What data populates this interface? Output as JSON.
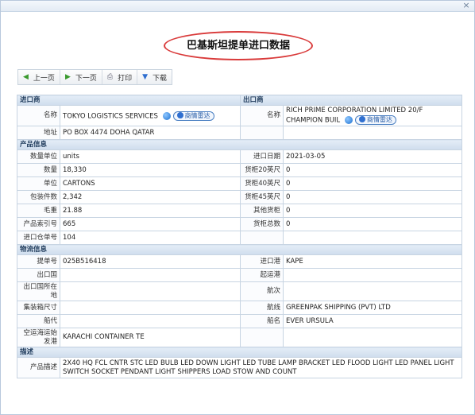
{
  "window": {
    "close_icon": "close-icon"
  },
  "page": {
    "title": "巴基斯坦提单进口数据"
  },
  "toolbar": {
    "prev_label": "上一页",
    "next_label": "下一页",
    "print_label": "打印",
    "download_label": "下载"
  },
  "importer": {
    "section_title": "进口商",
    "name_label": "名称",
    "name_value": "TOKYO LOGISTICS SERVICES",
    "address_label": "地址",
    "address_value": "PO BOX 4474 DOHA QATAR",
    "badge_label": "商情雷达"
  },
  "exporter": {
    "section_title": "出口商",
    "name_label": "名称",
    "name_value": "RICH PRIME CORPORATION LIMITED 20/F CHAMPION BUIL",
    "badge_label": "商情雷达"
  },
  "product": {
    "section_title": "产品信息",
    "rows": [
      {
        "l_label": "数量单位",
        "l_value": "units",
        "r_label": "进口日期",
        "r_value": "2021-03-05"
      },
      {
        "l_label": "数量",
        "l_value": "18,330",
        "r_label": "货柜20英尺",
        "r_value": "0"
      },
      {
        "l_label": "单位",
        "l_value": "CARTONS",
        "r_label": "货柜40英尺",
        "r_value": "0"
      },
      {
        "l_label": "包装件数",
        "l_value": "2,342",
        "r_label": "货柜45英尺",
        "r_value": "0"
      },
      {
        "l_label": "毛重",
        "l_value": "21.88",
        "r_label": "其他货柜",
        "r_value": "0"
      },
      {
        "l_label": "产品索引号",
        "l_value": "665",
        "r_label": "货柜总数",
        "r_value": "0"
      },
      {
        "l_label": "进口仓单号",
        "l_value": "104",
        "r_label": "",
        "r_value": ""
      }
    ]
  },
  "logistics": {
    "section_title": "物流信息",
    "rows": [
      {
        "l_label": "提单号",
        "l_value": "025B516418",
        "r_label": "进口港",
        "r_value": "KAPE"
      },
      {
        "l_label": "出口国",
        "l_value": "",
        "r_label": "起运港",
        "r_value": ""
      },
      {
        "l_label": "出口国所在地",
        "l_value": "",
        "r_label": "航次",
        "r_value": ""
      },
      {
        "l_label": "集装箱尺寸",
        "l_value": "",
        "r_label": "航线",
        "r_value": "GREENPAK SHIPPING (PVT) LTD"
      },
      {
        "l_label": "船代",
        "l_value": "",
        "r_label": "船名",
        "r_value": "EVER URSULA"
      },
      {
        "l_label": "空运海运始发港",
        "l_value": "KARACHI CONTAINER TE",
        "r_label": "",
        "r_value": ""
      }
    ]
  },
  "description": {
    "section_title": "描述",
    "label": "产品描述",
    "value": "2X40 HQ FCL CNTR STC LED BULB LED DOWN LIGHT LED TUBE LAMP BRACKET LED FLOOD LIGHT LED PANEL LIGHT SWITCH SOCKET PENDANT LIGHT SHIPPERS LOAD STOW AND COUNT"
  },
  "colors": {
    "section_header_bg": "#d7e3f0",
    "border": "#c7d4e2",
    "title_ellipse": "#d93a3a"
  }
}
